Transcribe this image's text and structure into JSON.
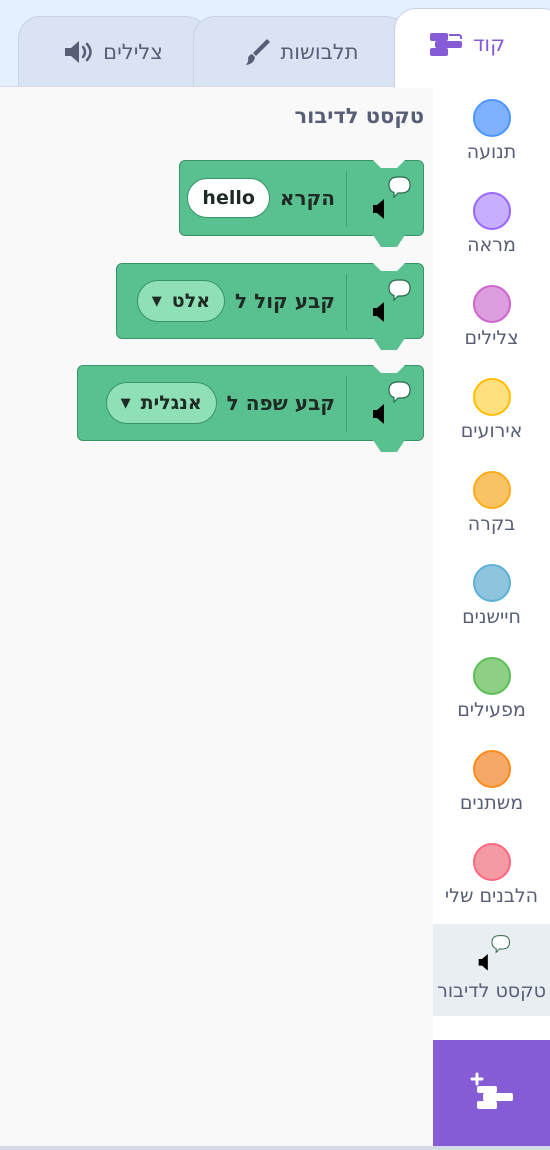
{
  "tabs": {
    "code": "קוד",
    "costumes": "תלבושות",
    "sounds": "צלילים"
  },
  "categories": [
    {
      "label": "תנועה",
      "color": "#4c97ff",
      "fill": "#7fb1ff"
    },
    {
      "label": "מראה",
      "color": "#9966ff",
      "fill": "#c7aeff"
    },
    {
      "label": "צלילים",
      "color": "#cf63cf",
      "fill": "#dd9ee0"
    },
    {
      "label": "אירועים",
      "color": "#ffbf00",
      "fill": "#ffdf7f"
    },
    {
      "label": "בקרה",
      "color": "#ffab19",
      "fill": "#f9c365"
    },
    {
      "label": "חיישנים",
      "color": "#5cb1d6",
      "fill": "#8ec4dd"
    },
    {
      "label": "מפעילים",
      "color": "#59c059",
      "fill": "#8fcf85"
    },
    {
      "label": "משתנים",
      "color": "#ff8c1a",
      "fill": "#f6a867"
    },
    {
      "label": "הלבנים שלי",
      "color": "#ff6680",
      "fill": "#f39aa4"
    },
    {
      "label": "טקסט לדיבור",
      "icon": "text-to-speech-icon"
    }
  ],
  "palette": {
    "title": "טקסט לדיבור",
    "blocks": [
      {
        "text": "הקרא",
        "input": "hello"
      },
      {
        "text": "קבע קול ל",
        "dropdown": "אלט"
      },
      {
        "text": "קבע שפה ל",
        "dropdown": "אנגלית"
      }
    ]
  },
  "colors": {
    "accent": "#855cd6",
    "block_green": "#59c08f",
    "block_border": "#389466"
  }
}
